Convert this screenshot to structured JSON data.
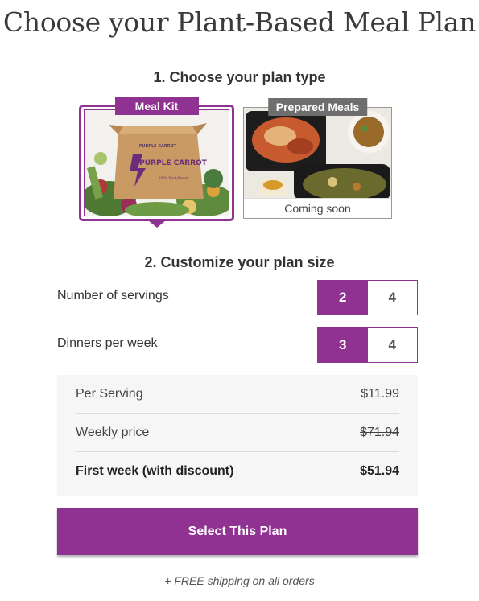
{
  "title": "Choose your Plant-Based Meal Plan",
  "step1": {
    "heading": "1. Choose your plan type",
    "cards": [
      {
        "badge": "Meal Kit",
        "image": "purple-carrot-box-photo",
        "box_text": "PURPLE CARROT",
        "box_small_text": "100% Plant-Based",
        "selected": true
      },
      {
        "badge": "Prepared Meals",
        "image": "prepared-meals-photo",
        "caption": "Coming soon",
        "selected": false
      }
    ]
  },
  "step2": {
    "heading": "2. Customize your plan size",
    "servings": {
      "label": "Number of servings",
      "options": [
        "2",
        "4"
      ],
      "selected": "2"
    },
    "dinners": {
      "label": "Dinners per week",
      "options": [
        "3",
        "4"
      ],
      "selected": "3"
    }
  },
  "pricing": {
    "per_serving_label": "Per Serving",
    "per_serving_value": "$11.99",
    "weekly_label": "Weekly price",
    "weekly_value": "$71.94",
    "first_week_label": "First week (with discount)",
    "first_week_value": "$51.94"
  },
  "cta": {
    "label": "Select This Plan"
  },
  "footer_note": "+ FREE shipping on all orders",
  "colors": {
    "accent": "#8f3292",
    "badge_gray": "#6e6e6e",
    "panel_bg": "#f6f6f6"
  }
}
